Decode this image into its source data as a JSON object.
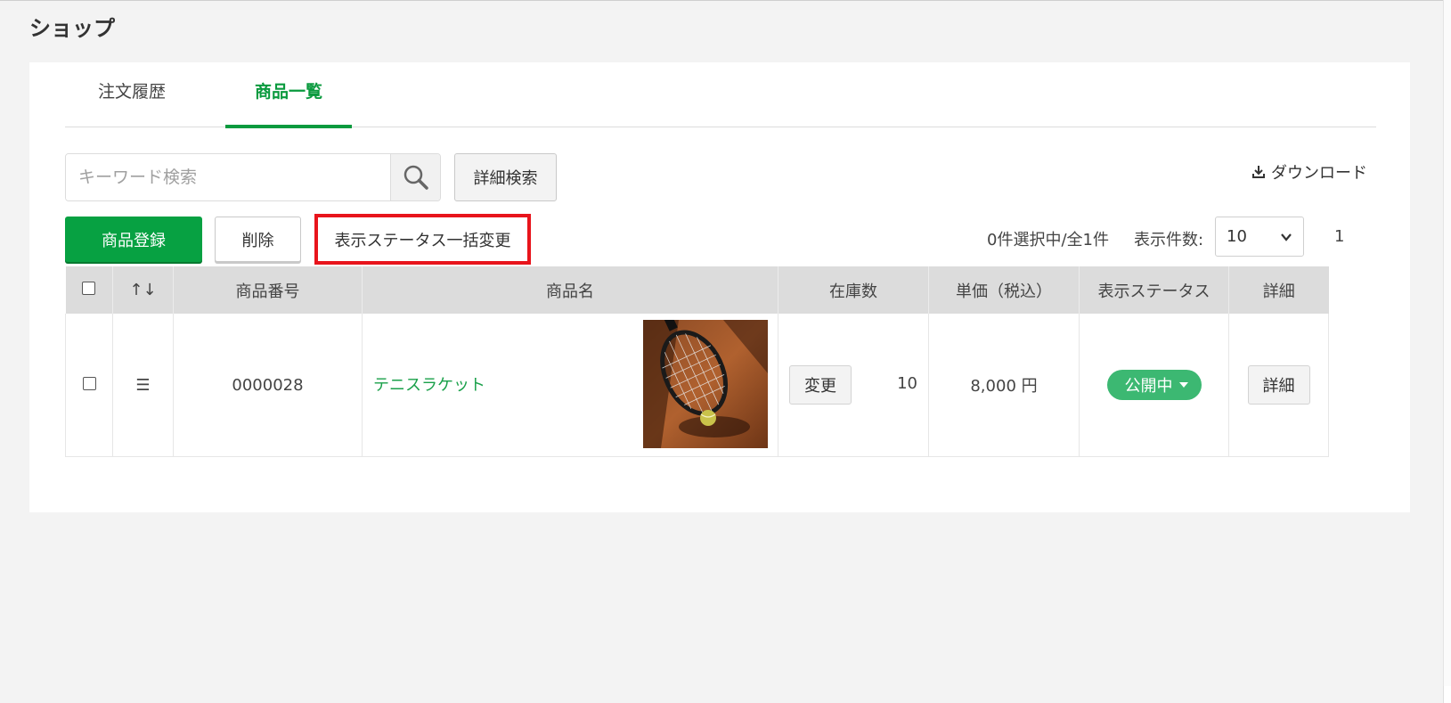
{
  "page": {
    "title": "ショップ"
  },
  "tabs": [
    {
      "label": "注文履歴",
      "active": false
    },
    {
      "label": "商品一覧",
      "active": true
    }
  ],
  "search": {
    "placeholder": "キーワード検索",
    "value": ""
  },
  "toolbar": {
    "detail_search_label": "詳細検索",
    "download_label": "ダウンロード",
    "register_label": "商品登録",
    "delete_label": "削除",
    "bulk_status_label": "表示ステータス一括変更",
    "selection_count": "0件選択中/全1件",
    "per_page_label": "表示件数:",
    "per_page_value": "10",
    "page_number": "1"
  },
  "table": {
    "headers": [
      "↑↓",
      "商品番号",
      "商品名",
      "在庫数",
      "単価（税込）",
      "表示ステータス",
      "詳細"
    ],
    "rows": [
      {
        "handle": "☰",
        "product_number": "0000028",
        "product_name": "テニスラケット",
        "change_label": "変更",
        "stock": "10",
        "price": "8,000 円",
        "status": "公開中",
        "detail_label": "詳細"
      }
    ]
  },
  "colors": {
    "accent_green": "#0a9a3e",
    "status_green": "#3cb872",
    "highlight_red": "#e8141c"
  },
  "icons": [
    "search-icon",
    "download-icon",
    "chevron-down-icon",
    "drag-handle-icon",
    "caret-down-icon"
  ]
}
